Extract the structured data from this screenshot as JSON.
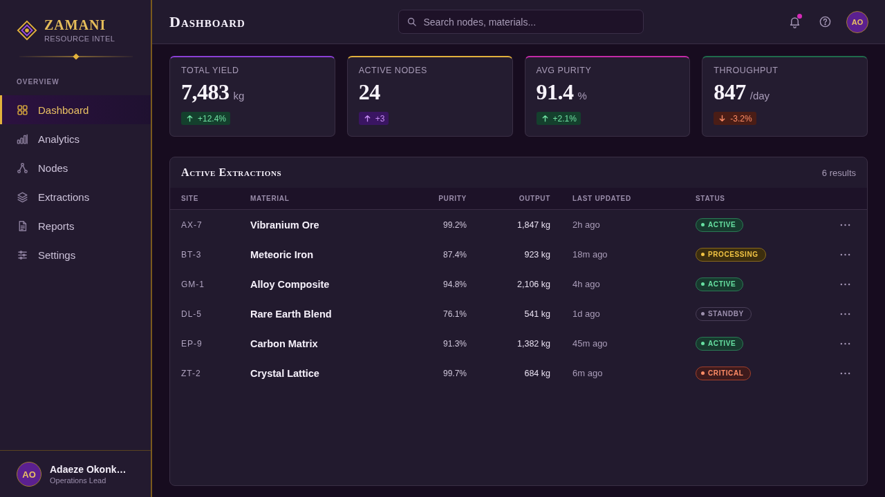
{
  "sidebar": {
    "brand": {
      "name": "ZAMANI",
      "tagline": "RESOURCE INTEL"
    },
    "section": "OVERVIEW",
    "items": [
      {
        "label": "Dashboard",
        "selected": true
      },
      {
        "label": "Analytics",
        "selected": false
      },
      {
        "label": "Nodes",
        "selected": false
      },
      {
        "label": "Extractions",
        "selected": false
      },
      {
        "label": "Reports",
        "selected": false
      },
      {
        "label": "Settings",
        "selected": false
      }
    ],
    "user": {
      "initials": "AO",
      "name": "Adaeze Okonk…",
      "role": "Operations Lead"
    }
  },
  "header": {
    "title": "Dashboard",
    "search": {
      "placeholder": "Search nodes, materials..."
    },
    "notifications": {
      "unread": true
    },
    "avatar": {
      "initials": "AO"
    }
  },
  "stats": [
    {
      "label": "TOTAL YIELD",
      "value": "7,483",
      "unit": "kg",
      "change": "+12.4%",
      "rising": true,
      "kind": "positive",
      "color": "#8b3fd6"
    },
    {
      "label": "ACTIVE NODES",
      "value": "24",
      "change": "+3",
      "rising": true,
      "kind": "accent",
      "color": "#e2b13c"
    },
    {
      "label": "AVG PURITY",
      "value": "91.4",
      "unit": "%",
      "change": "+2.1%",
      "rising": true,
      "kind": "positive",
      "color": "#c42aa8"
    },
    {
      "label": "THROUGHPUT",
      "value": "847",
      "unit": "/day",
      "change": "-3.2%",
      "rising": false,
      "kind": "negative",
      "color": "#1f6b4c"
    }
  ],
  "table": {
    "title": "Active Extractions",
    "count": "6 results",
    "columns": [
      "SITE",
      "MATERIAL",
      "PURITY",
      "OUTPUT",
      "LAST UPDATED",
      "STATUS"
    ],
    "rows": [
      {
        "site": "AX-7",
        "material": "Vibranium Ore",
        "purity": "99.2%",
        "output": "1,847 kg",
        "updated": "2h ago",
        "status": {
          "label": "ACTIVE",
          "kind": "active"
        }
      },
      {
        "site": "BT-3",
        "material": "Meteoric Iron",
        "purity": "87.4%",
        "output": "923 kg",
        "updated": "18m ago",
        "status": {
          "label": "PROCESSING",
          "kind": "processing"
        }
      },
      {
        "site": "GM-1",
        "material": "Alloy Composite",
        "purity": "94.8%",
        "output": "2,106 kg",
        "updated": "4h ago",
        "status": {
          "label": "ACTIVE",
          "kind": "active"
        }
      },
      {
        "site": "DL-5",
        "material": "Rare Earth Blend",
        "purity": "76.1%",
        "output": "541 kg",
        "updated": "1d ago",
        "status": {
          "label": "STANDBY",
          "kind": "standby"
        }
      },
      {
        "site": "EP-9",
        "material": "Carbon Matrix",
        "purity": "91.3%",
        "output": "1,382 kg",
        "updated": "45m ago",
        "status": {
          "label": "ACTIVE",
          "kind": "active"
        }
      },
      {
        "site": "ZT-2",
        "material": "Crystal Lattice",
        "purity": "99.7%",
        "output": "684 kg",
        "updated": "6m ago",
        "status": {
          "label": "CRITICAL",
          "kind": "critical"
        }
      }
    ]
  }
}
